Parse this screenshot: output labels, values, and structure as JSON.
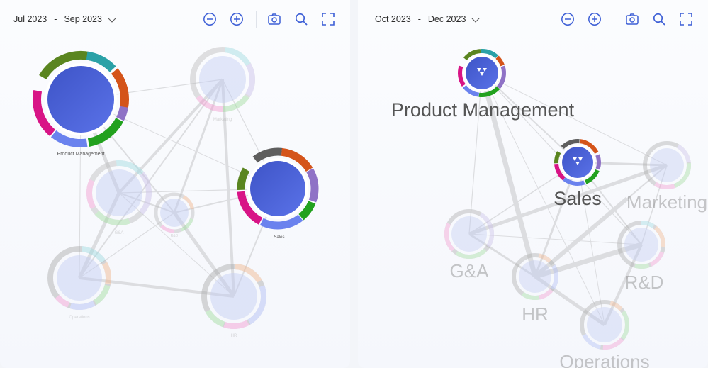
{
  "panels": {
    "left": {
      "range_start": "Jul 2023",
      "range_sep": "-",
      "range_end": "Sep 2023",
      "node_labels": {
        "product_management": "Product Management",
        "marketing": "Marketing",
        "sales": "Sales",
        "ga": "G&A",
        "rd": "R&D",
        "operations": "Operations",
        "hr": "HR"
      }
    },
    "right": {
      "range_start": "Oct 2023",
      "range_sep": "-",
      "range_end": "Dec 2023",
      "node_labels": {
        "product_management": "Product Management",
        "sales": "Sales",
        "marketing": "Marketing",
        "ga": "G&A",
        "rd": "R&D",
        "hr": "HR",
        "operations": "Operations"
      }
    }
  },
  "toolbar_icons": [
    "zoom-out-icon",
    "zoom-in-icon",
    "camera-icon",
    "search-icon",
    "fullscreen-icon"
  ],
  "colors": {
    "accent": "#3d5fd6",
    "node_core": "#4a5fd8",
    "segment_teal": "#2aa1a7",
    "segment_orange": "#d4541a",
    "segment_purple": "#8f72c6",
    "segment_green": "#22a11e",
    "segment_blue": "#6a82ee",
    "segment_magenta": "#d81486",
    "segment_olive": "#5a8520",
    "segment_gray": "#5e5e5e"
  }
}
